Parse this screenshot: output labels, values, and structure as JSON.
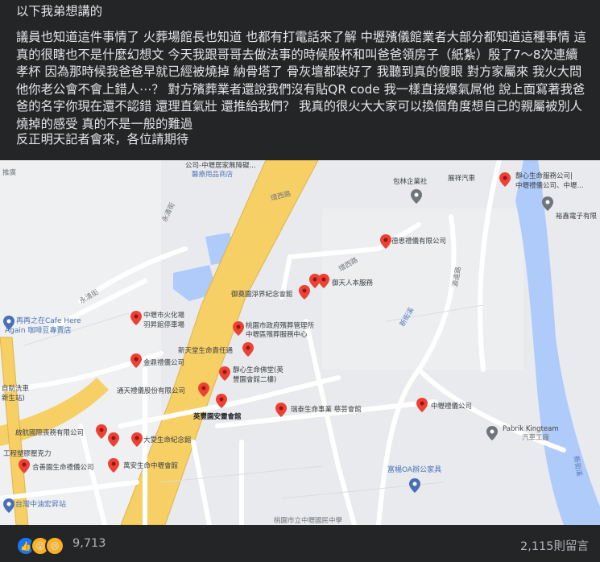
{
  "post": {
    "intro": "以下我弟想講的",
    "body": "議員也知道這件事情了 火葬場館長也知道 也都有打電話來了解 中壢殯儀館業者大部分都知道這種事情 這真的很瞎也不是什麼幻想文 今天我跟哥哥去做法事的時候殷杯和叫爸爸領房子（紙紮）殷了7～8次連續孝杯 因為那時候我爸爸早就已經被燒掉 納骨塔了 骨灰壇都裝好了 我聽到真的傻眼 對方家屬來 我火大問他你老公會不會上錯人⋯？ 對方殯葬業者還說我們沒有貼QR code 我一樣直接爆氣屌他 說上面寫著我爸爸的名字你現在還不認錯 還理直氣壯 還推給我們？ 我真的很火大大家可以換個角度想自己的親屬被別人燒掉的感受 真的不是一般的難過",
    "closing": "反正明天記者會來，各位請期待"
  },
  "map": {
    "labels": {
      "company_top": "公司-中壢居家無障礙...",
      "company_top2": "醫療用品商店",
      "baolin": "包林企業社",
      "zhanxiang": "展祥汽車",
      "jingxin_top": "靜心生命服務公司|",
      "jingxin_top2": "中壢禮儀公司、中壢...",
      "yuxin": "裕鑫電子有限",
      "desi": "德思禮儀有限公司",
      "yutian": "御天人本服務",
      "yuying": "御奠園淨界紀念會館",
      "zhongli_crem1": "中壢市火化場",
      "zhongli_crem2": "羽昇館停車場",
      "taoyuan_gov1": "桃園市政府殯葬管理所",
      "taoyuan_gov2": "中壢區殯葬服務中心",
      "xintian": "新天堂生命責任通",
      "jinding": "金鼎禮儀公司",
      "jingxin_mid1": "靜心生命佛堂(英",
      "jingxin_mid2": "豐園會館二樓)",
      "tongtian": "通天禮儀股份有限公司",
      "yingfeng": "英豐園安靈會館",
      "ruitai": "瑞泰生命事業 慈芸會館",
      "zhongli_etiquette": "中壢禮儀公司",
      "qihang": "啟航國際喪務有限公司",
      "daai": "大愛生命紀念館",
      "heshan": "合善園生命禮儀公司",
      "wanan": "萬安生命中壢會館",
      "pabrik": "Pabrik Kingteam",
      "pabrik2": "汽車工廠",
      "fuyang": "富楊OA辦公家具",
      "cafe1": "再再之在Cafe Here",
      "cafe2": "Again 咖啡豆專賣店",
      "gas": "台灣中油宏昇站",
      "workshop": "工程塑膠壓克力",
      "wash1": "自助洗車",
      "wash2": "新生站)",
      "road_xinjie": "新街溪",
      "road_xinjie2": "新街溪",
      "road_bottom": "桃園市立中壢國民中學",
      "pushcar": "推廣",
      "yongqing": "永清街",
      "yongqing2": "永清街",
      "huanxi": "環西路",
      "huanxi2": "環西路",
      "yuanda": "源遠路"
    }
  },
  "footer": {
    "reaction_icons": [
      "like-icon",
      "wow-icon",
      "sad-icon"
    ],
    "reaction_count": "9,713",
    "comment_count": "2,115則留言"
  },
  "colors": {
    "background": "#242526",
    "text": "#e4e6eb",
    "muted": "#b0b3b8",
    "pin": "#ea4335",
    "highway": "#f6cf65",
    "water": "#aecbfa"
  }
}
